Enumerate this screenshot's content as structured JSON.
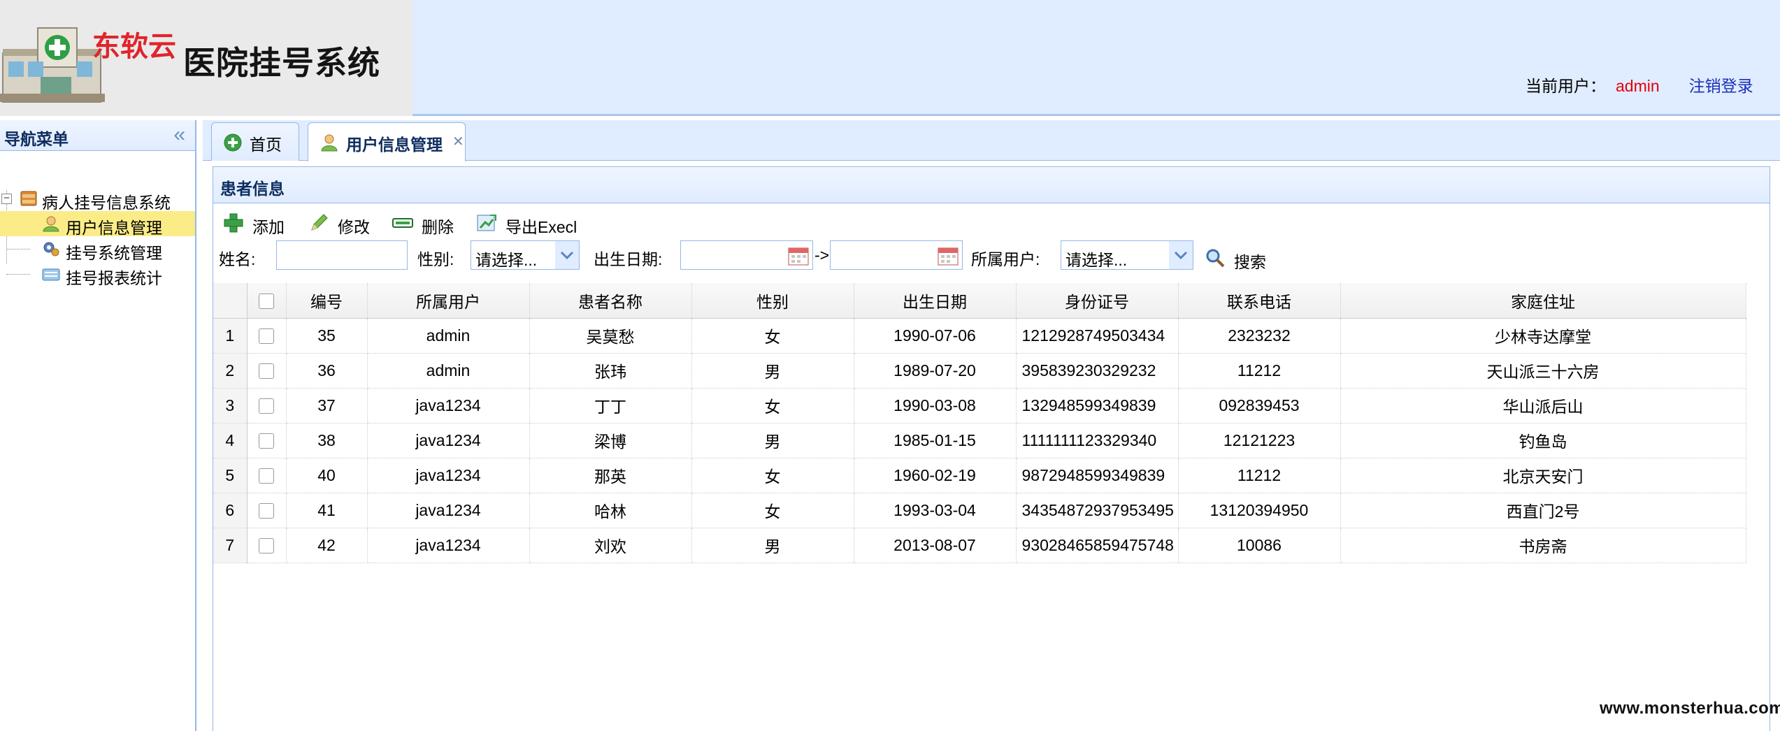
{
  "header": {
    "brand": "东软云",
    "system_title": "医院挂号系统",
    "current_user_label": "当前用户：",
    "current_user": "admin",
    "logout": "注销登录"
  },
  "sidebar": {
    "title": "导航菜单",
    "root": "病人挂号信息系统",
    "items": [
      {
        "label": "用户信息管理",
        "icon": "user-icon",
        "selected": true
      },
      {
        "label": "挂号系统管理",
        "icon": "settings-group-icon",
        "selected": false
      },
      {
        "label": "挂号报表统计",
        "icon": "report-icon",
        "selected": false
      }
    ]
  },
  "tabs": [
    {
      "label": "首页",
      "icon": "home-icon"
    },
    {
      "label": "用户信息管理",
      "icon": "user-icon",
      "closable": true
    }
  ],
  "panel": {
    "title": "患者信息",
    "toolbar": {
      "add": "添加",
      "edit": "修改",
      "delete": "删除",
      "export": "导出Execl"
    },
    "search": {
      "name_label": "姓名:",
      "name_value": "",
      "gender_label": "性别:",
      "gender_value": "请选择...",
      "birth_label": "出生日期:",
      "birth_from": "",
      "range_sep": "->",
      "birth_to": "",
      "owner_label": "所属用户:",
      "owner_value": "请选择...",
      "search_button": "搜索"
    }
  },
  "grid": {
    "columns": [
      "编号",
      "所属用户",
      "患者名称",
      "性别",
      "出生日期",
      "身份证号",
      "联系电话",
      "家庭住址"
    ],
    "rows": [
      {
        "rownum": "1",
        "cells": [
          "35",
          "admin",
          "吴莫愁",
          "女",
          "1990-07-06",
          "1212928749503434",
          "2323232",
          "少林寺达摩堂"
        ]
      },
      {
        "rownum": "2",
        "cells": [
          "36",
          "admin",
          "张玮",
          "男",
          "1989-07-20",
          "395839230329232",
          "11212",
          "天山派三十六房"
        ]
      },
      {
        "rownum": "3",
        "cells": [
          "37",
          "java1234",
          "丁丁",
          "女",
          "1990-03-08",
          "132948599349839",
          "092839453",
          "华山派后山"
        ]
      },
      {
        "rownum": "4",
        "cells": [
          "38",
          "java1234",
          "梁博",
          "男",
          "1985-01-15",
          "1111111123329340",
          "12121223",
          "钓鱼岛"
        ]
      },
      {
        "rownum": "5",
        "cells": [
          "40",
          "java1234",
          "那英",
          "女",
          "1960-02-19",
          "9872948599349839",
          "11212",
          "北京天安门"
        ]
      },
      {
        "rownum": "6",
        "cells": [
          "41",
          "java1234",
          "哈林",
          "女",
          "1993-03-04",
          "34354872937953495",
          "13120394950",
          "西直门2号"
        ]
      },
      {
        "rownum": "7",
        "cells": [
          "42",
          "java1234",
          "刘欢",
          "男",
          "2013-08-07",
          "93028465859475748",
          "10086",
          "书房斋"
        ]
      }
    ]
  },
  "watermark": "www.monsterhua.com"
}
